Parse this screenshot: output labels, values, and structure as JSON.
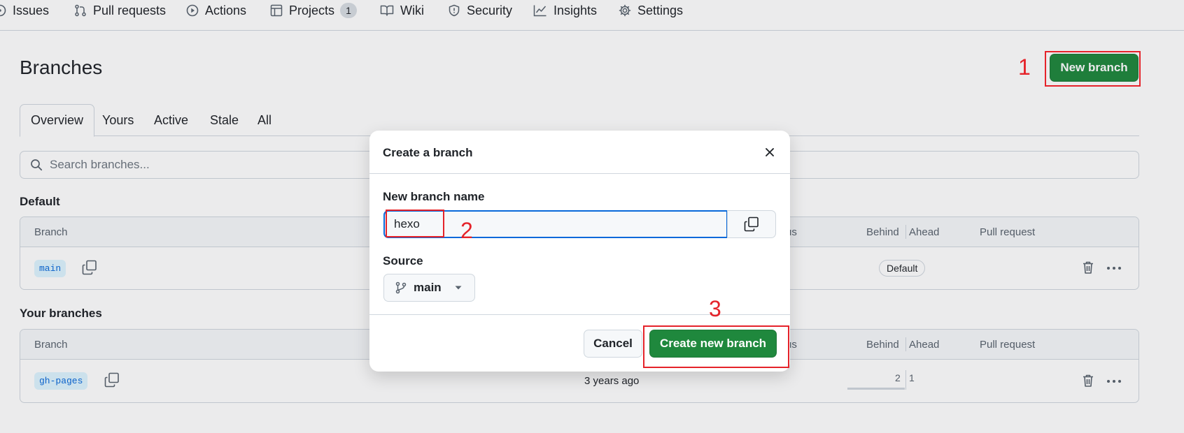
{
  "nav": {
    "items": [
      {
        "label": "Issues",
        "icon": "issue-opened-icon"
      },
      {
        "label": "Pull requests",
        "icon": "git-pull-request-icon"
      },
      {
        "label": "Actions",
        "icon": "play-icon"
      },
      {
        "label": "Projects",
        "icon": "table-icon",
        "counter": "1"
      },
      {
        "label": "Wiki",
        "icon": "book-icon"
      },
      {
        "label": "Security",
        "icon": "shield-icon"
      },
      {
        "label": "Insights",
        "icon": "graph-icon"
      },
      {
        "label": "Settings",
        "icon": "gear-icon"
      }
    ]
  },
  "page": {
    "title": "Branches",
    "new_branch_label": "New branch"
  },
  "tabs": [
    "Overview",
    "Yours",
    "Active",
    "Stale",
    "All"
  ],
  "search": {
    "placeholder": "Search branches..."
  },
  "default_section": {
    "heading": "Default",
    "columns": {
      "branch": "Branch",
      "status": "us",
      "behind": "Behind",
      "ahead": "Ahead",
      "pull_request": "Pull request"
    },
    "rows": [
      {
        "name": "main",
        "badge": "Default"
      }
    ]
  },
  "your_section": {
    "heading": "Your branches",
    "columns": {
      "branch": "Branch",
      "status": "us",
      "behind": "Behind",
      "ahead": "Ahead",
      "pull_request": "Pull request"
    },
    "rows": [
      {
        "name": "gh-pages",
        "updated": "3 years ago",
        "behind": "2",
        "ahead": "1"
      }
    ]
  },
  "modal": {
    "title": "Create a branch",
    "name_label": "New branch name",
    "name_value": "hexo",
    "source_label": "Source",
    "source_value": "main",
    "cancel_label": "Cancel",
    "create_label": "Create new branch"
  },
  "annotations": [
    "1",
    "2",
    "3"
  ],
  "colors": {
    "primary_green": "#1f883d",
    "annotation_red": "#e5232a",
    "focus_blue": "#0969da"
  }
}
